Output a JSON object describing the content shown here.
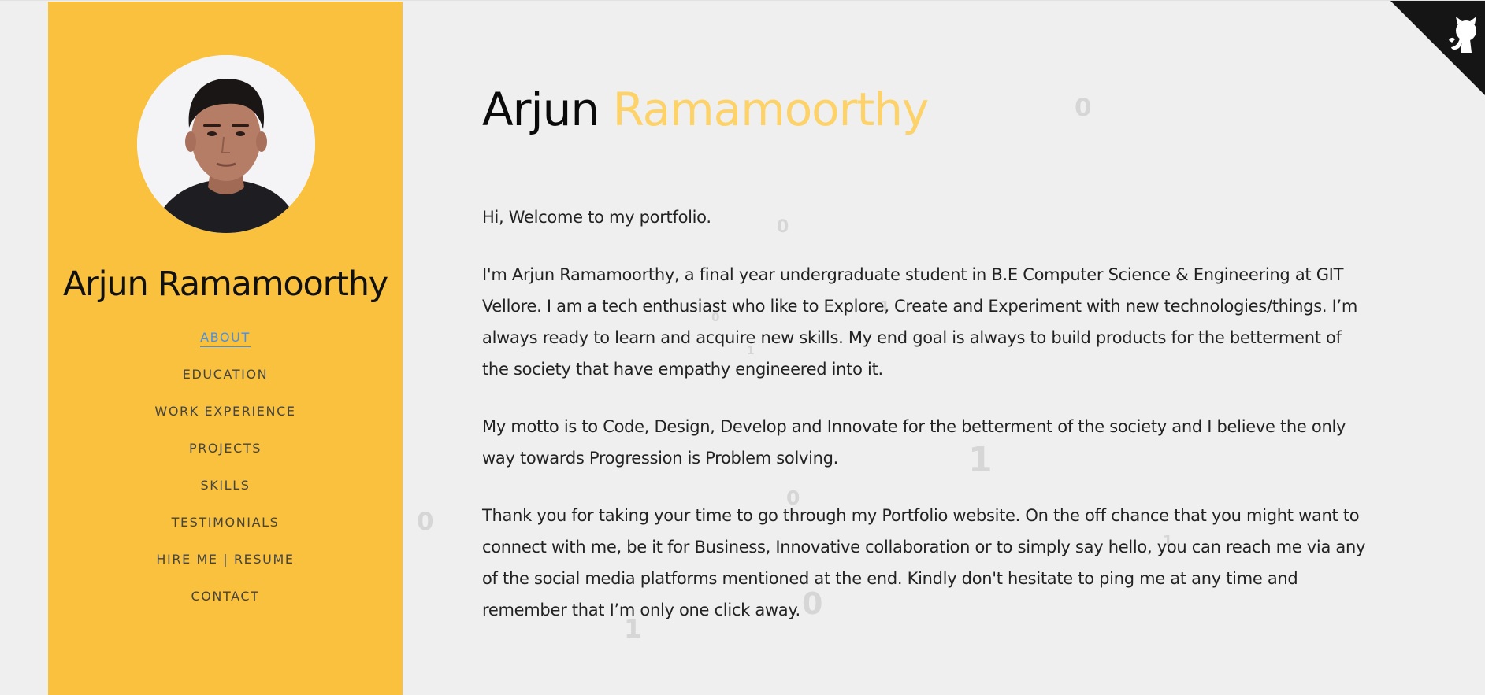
{
  "sidebar": {
    "name": "Arjun Ramamoorthy",
    "nav": [
      {
        "label": "ABOUT",
        "active": true
      },
      {
        "label": "EDUCATION"
      },
      {
        "label": "WORK EXPERIENCE"
      },
      {
        "label": "PROJECTS"
      },
      {
        "label": "SKILLS"
      },
      {
        "label": "TESTIMONIALS"
      },
      {
        "label": "HIRE ME | RESUME"
      },
      {
        "label": "CONTACT"
      }
    ]
  },
  "main": {
    "title_first": "Arjun",
    "title_last": "Ramamoorthy",
    "paragraphs": [
      "Hi, Welcome to my portfolio.",
      "I'm Arjun Ramamoorthy, a final year undergraduate student in B.E Computer Science & Engineering at GIT Vellore. I am a tech enthusiast who like to Explore, Create and Experiment with new technologies/things. I’m always ready to learn and acquire new skills. My end goal is always to build products for the betterment of the society that have empathy engineered into it.",
      "My motto is to Code, Design, Develop and Innovate for the betterment of the society and I believe the only way towards Progression is Problem solving.",
      "Thank you for taking your time to go through my Portfolio website. On the off chance that you might want to connect with me, be it for Business, Innovative collaboration or to simply say hello, you can reach me via any of the social media platforms mentioned at the end. Kindly don't hesitate to ping me at any time and remember that I’m only one click away."
    ]
  },
  "binary_digits": [
    "0",
    "0",
    "0",
    "1",
    "1",
    "1",
    "0",
    "0",
    "1",
    "0",
    "1"
  ],
  "icons": {
    "github": "github-octocat-icon"
  },
  "colors": {
    "sidebar": "#f9c13d",
    "accent_name": "#fcd269",
    "nav_active": "#4a90e2",
    "corner": "#151515"
  }
}
